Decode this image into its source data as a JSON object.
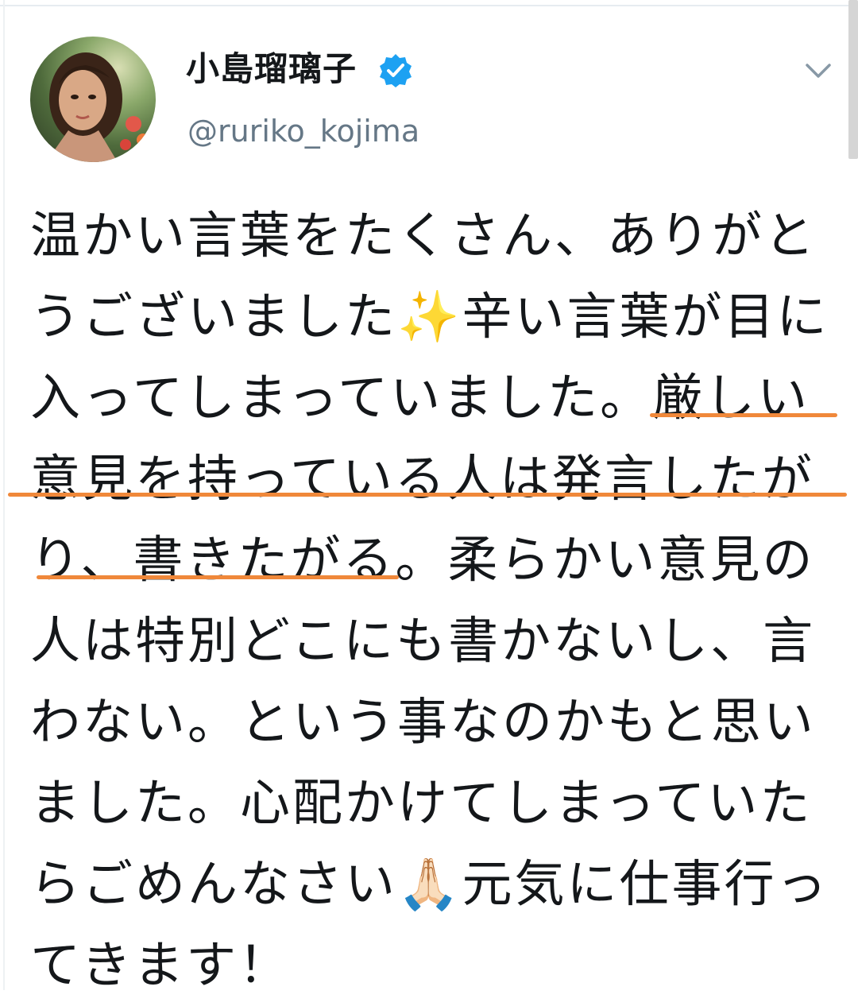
{
  "user": {
    "display_name": "小島瑠璃子",
    "handle": "@ruriko_kojima",
    "verified": true
  },
  "icons": {
    "verified": "verified-badge-icon",
    "more": "chevron-down-icon"
  },
  "colors": {
    "verified_blue": "#1da1f2",
    "highlight_underline": "#f0883a",
    "handle_gray": "#657786"
  },
  "tweet": {
    "lines": [
      "温かい言葉をたくさん、ありがと",
      "うございました✨辛い言葉が目に",
      "入ってしまっていました。厳しい",
      "意見を持っている人は発言したが",
      "り、書きたがる。柔らかい意見の",
      "人は特別どこにも書かないし、言",
      "わない。という事なのかもと思い",
      "ました。心配かけてしまっていた",
      "らごめんなさい🙏🏻元気に仕事行っ",
      "てきます！"
    ]
  }
}
